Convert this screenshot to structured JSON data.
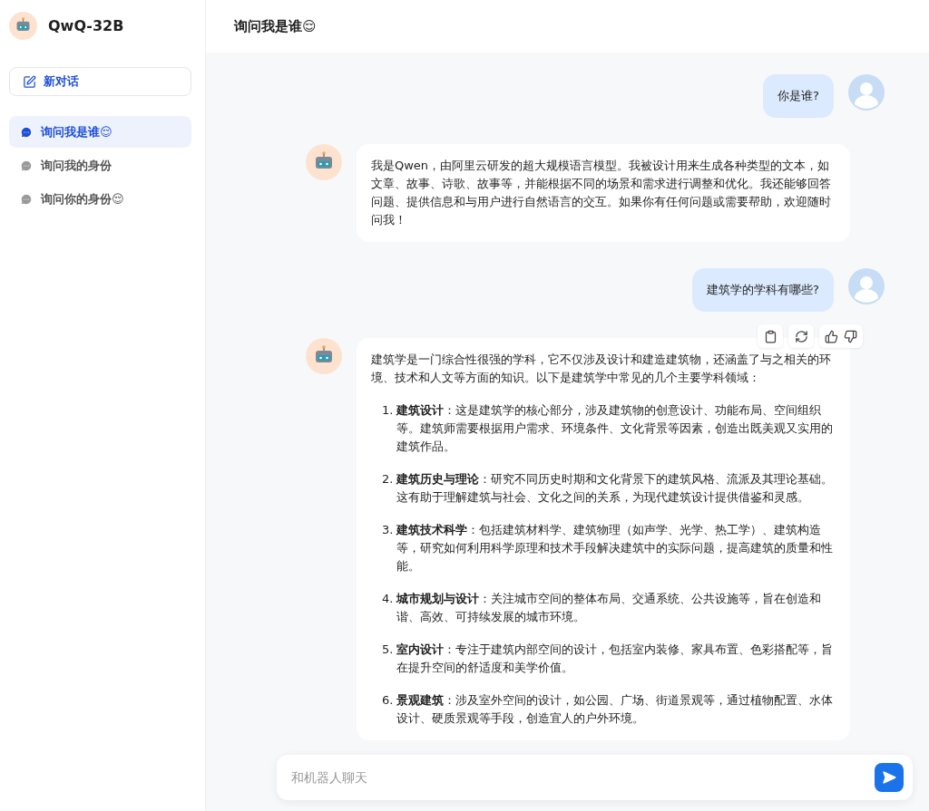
{
  "app": {
    "name": "QwQ-32B"
  },
  "new_chat": {
    "label": "新对话"
  },
  "conversations": [
    {
      "title": "询问我是谁😌",
      "selected": true
    },
    {
      "title": "询问我的身份",
      "selected": false
    },
    {
      "title": "询问你的身份😌",
      "selected": false
    }
  ],
  "header": {
    "title": "询问我是谁😌"
  },
  "messages": [
    {
      "kind": "user",
      "text": "你是谁?"
    },
    {
      "kind": "assistant",
      "show_actions": false,
      "paragraphs": [
        "我是Qwen，由阿里云研发的超大规模语言模型。我被设计用来生成各种类型的文本，如文章、故事、诗歌、故事等，并能根据不同的场景和需求进行调整和优化。我还能够回答问题、提供信息和与用户进行自然语言的交互。如果你有任何问题或需要帮助，欢迎随时问我！"
      ]
    },
    {
      "kind": "user",
      "text": "建筑学的学科有哪些?"
    },
    {
      "kind": "assistant",
      "show_actions": true,
      "paragraphs": [
        "建筑学是一门综合性很强的学科，它不仅涉及设计和建造建筑物，还涵盖了与之相关的环境、技术和人文等方面的知识。以下是建筑学中常见的几个主要学科领域："
      ],
      "list": [
        {
          "number": "1.",
          "text": "**建筑设计**：这是建筑学的核心部分，涉及建筑物的创意设计、功能布局、空间组织等。建筑师需要根据用户需求、环境条件、文化背景等因素，创造出既美观又实用的建筑作品。"
        },
        {
          "number": "2.",
          "text": "**建筑历史与理论**：研究不同历史时期和文化背景下的建筑风格、流派及其理论基础。这有助于理解建筑与社会、文化之间的关系，为现代建筑设计提供借鉴和灵感。"
        },
        {
          "number": "3.",
          "text": "**建筑技术科学**：包括建筑材料学、建筑物理（如声学、光学、热工学）、建筑构造等，研究如何利用科学原理和技术手段解决建筑中的实际问题，提高建筑的质量和性能。"
        },
        {
          "number": "4.",
          "text": "**城市规划与设计**：关注城市空间的整体布局、交通系统、公共设施等，旨在创造和谐、高效、可持续发展的城市环境。"
        },
        {
          "number": "5.",
          "text": "**室内设计**：专注于建筑内部空间的设计，包括室内装修、家具布置、色彩搭配等，旨在提升空间的舒适度和美学价值。"
        },
        {
          "number": "6.",
          "text": "**景观建筑**：涉及室外空间的设计，如公园、广场、街道景观等，通过植物配置、水体设计、硬质景观等手段，创造宜人的户外环境。"
        }
      ]
    }
  ],
  "composer": {
    "placeholder": "和机器人聊天"
  }
}
